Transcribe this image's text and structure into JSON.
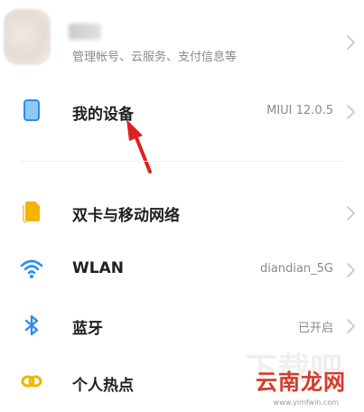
{
  "account": {
    "subtitle": "管理帐号、云服务、支付信息等"
  },
  "device": {
    "label": "我的设备",
    "value": "MIUI 12.0.5",
    "icon": "phone-icon"
  },
  "sim": {
    "label": "双卡与移动网络",
    "icon": "sim-card-icon"
  },
  "wlan": {
    "label": "WLAN",
    "value": "diandian_5G",
    "icon": "wifi-icon"
  },
  "bluetooth": {
    "label": "蓝牙",
    "value": "已开启",
    "icon": "bluetooth-icon"
  },
  "hotspot": {
    "label": "个人热点",
    "icon": "hotspot-icon"
  },
  "watermark": {
    "name": "云南龙网",
    "url": "www.ylmfwin.com"
  },
  "colors": {
    "accent_blue": "#2d8cf0",
    "sim_yellow": "#f5b400",
    "hotspot_yellow": "#f0b400",
    "annotation_red": "#e02020"
  }
}
